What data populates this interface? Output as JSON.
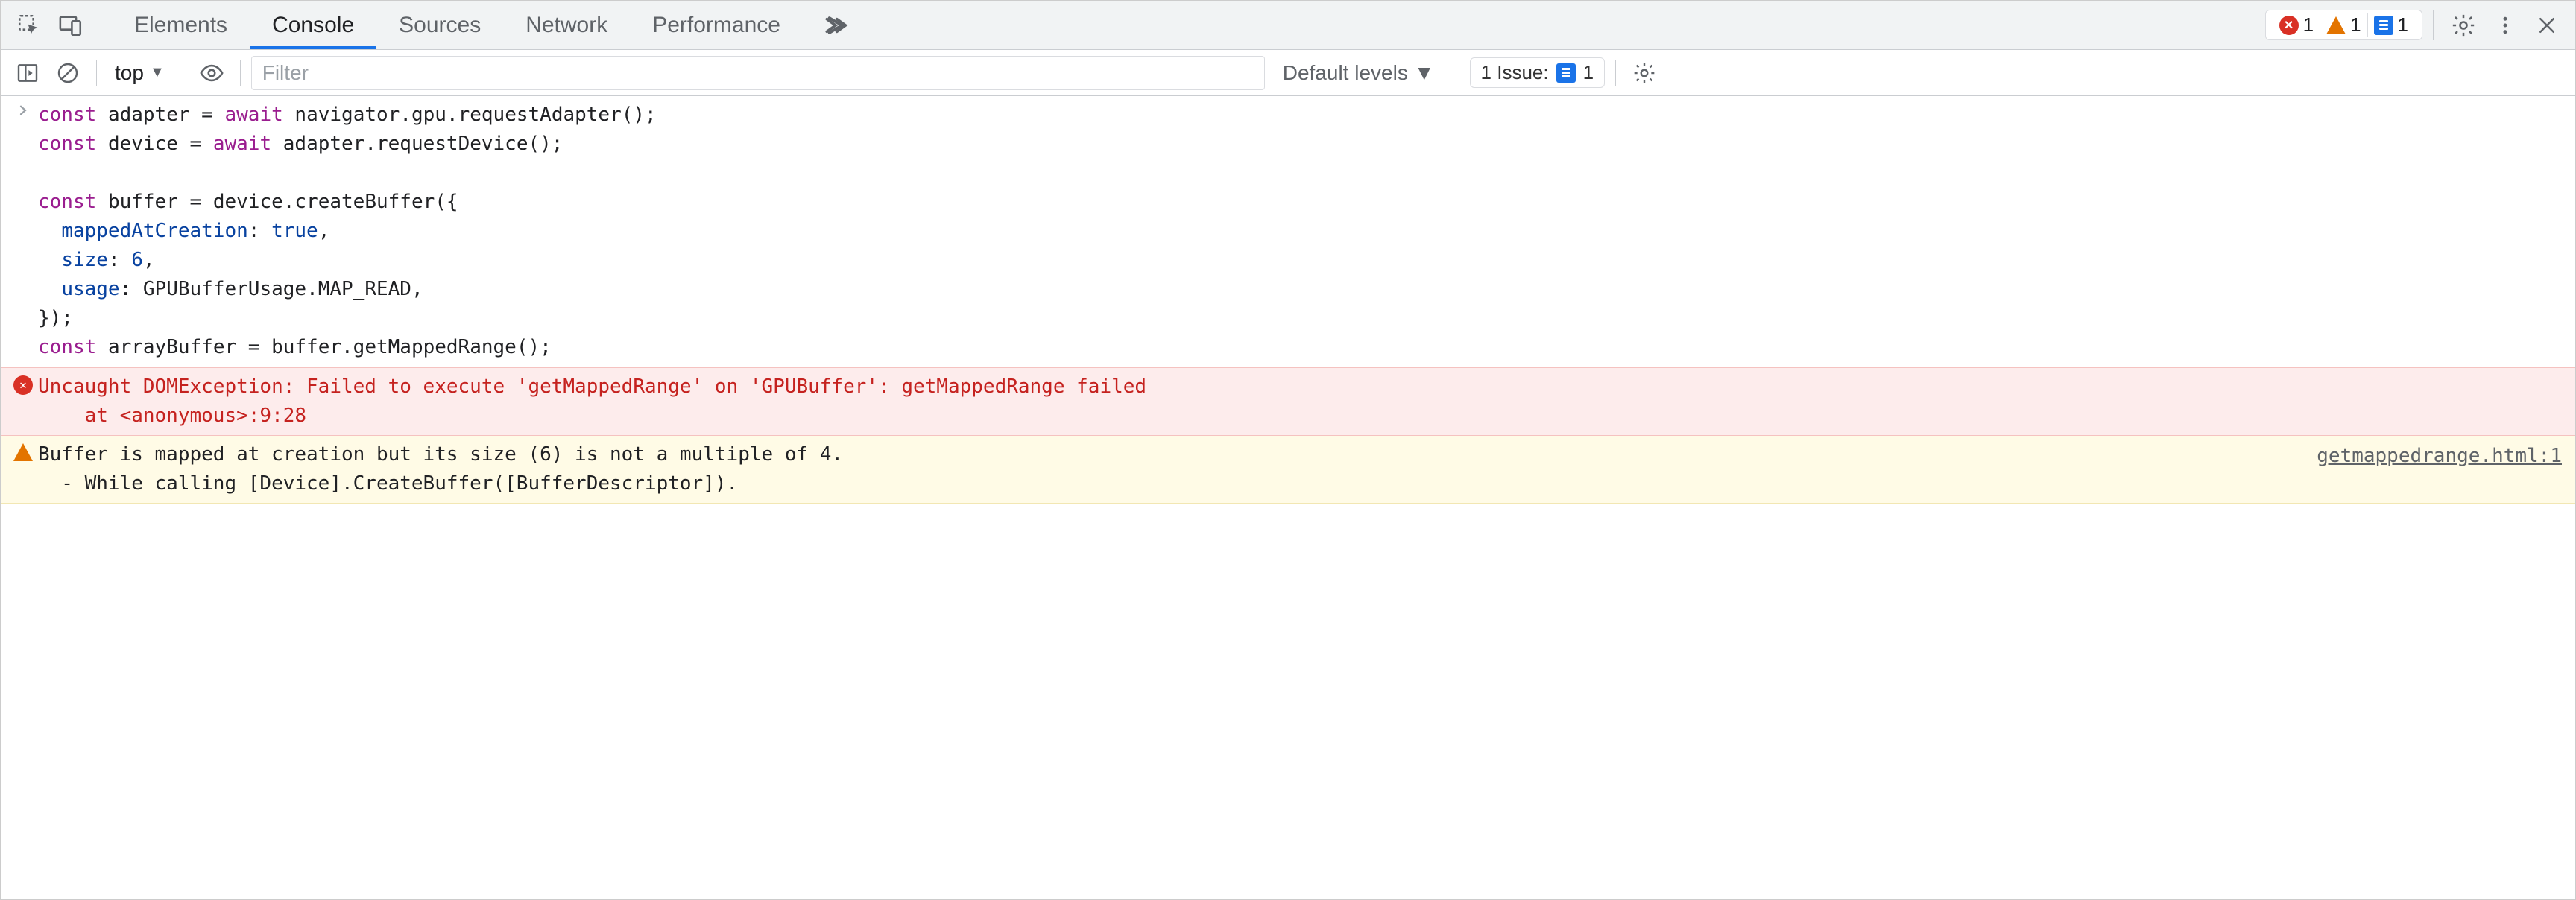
{
  "tabs": {
    "items": [
      "Elements",
      "Console",
      "Sources",
      "Network",
      "Performance"
    ],
    "active_index": 1
  },
  "badges": {
    "errors": "1",
    "warnings": "1",
    "info": "1"
  },
  "toolbar": {
    "context": "top",
    "filter_placeholder": "Filter",
    "levels_label": "Default levels",
    "issues_label": "1 Issue:",
    "issues_count": "1"
  },
  "code": {
    "tokens": [
      [
        "kw",
        "const"
      ],
      [
        "sp",
        " "
      ],
      [
        "ident",
        "adapter"
      ],
      [
        "sp",
        " "
      ],
      [
        "pun",
        "="
      ],
      [
        "sp",
        " "
      ],
      [
        "await",
        "await"
      ],
      [
        "sp",
        " "
      ],
      [
        "ident",
        "navigator"
      ],
      [
        "pun",
        "."
      ],
      [
        "ident",
        "gpu"
      ],
      [
        "pun",
        "."
      ],
      [
        "ident",
        "requestAdapter"
      ],
      [
        "pun",
        "();"
      ],
      [
        "nl"
      ],
      [
        "kw",
        "const"
      ],
      [
        "sp",
        " "
      ],
      [
        "ident",
        "device"
      ],
      [
        "sp",
        " "
      ],
      [
        "pun",
        "="
      ],
      [
        "sp",
        " "
      ],
      [
        "await",
        "await"
      ],
      [
        "sp",
        " "
      ],
      [
        "ident",
        "adapter"
      ],
      [
        "pun",
        "."
      ],
      [
        "ident",
        "requestDevice"
      ],
      [
        "pun",
        "();"
      ],
      [
        "nl"
      ],
      [
        "nl"
      ],
      [
        "kw",
        "const"
      ],
      [
        "sp",
        " "
      ],
      [
        "ident",
        "buffer"
      ],
      [
        "sp",
        " "
      ],
      [
        "pun",
        "="
      ],
      [
        "sp",
        " "
      ],
      [
        "ident",
        "device"
      ],
      [
        "pun",
        "."
      ],
      [
        "ident",
        "createBuffer"
      ],
      [
        "pun",
        "({"
      ],
      [
        "nl"
      ],
      [
        "sp",
        "  "
      ],
      [
        "prop",
        "mappedAtCreation"
      ],
      [
        "pun",
        ":"
      ],
      [
        "sp",
        " "
      ],
      [
        "bool",
        "true"
      ],
      [
        "pun",
        ","
      ],
      [
        "nl"
      ],
      [
        "sp",
        "  "
      ],
      [
        "prop",
        "size"
      ],
      [
        "pun",
        ":"
      ],
      [
        "sp",
        " "
      ],
      [
        "num",
        "6"
      ],
      [
        "pun",
        ","
      ],
      [
        "nl"
      ],
      [
        "sp",
        "  "
      ],
      [
        "prop",
        "usage"
      ],
      [
        "pun",
        ":"
      ],
      [
        "sp",
        " "
      ],
      [
        "ident",
        "GPUBufferUsage"
      ],
      [
        "pun",
        "."
      ],
      [
        "ident",
        "MAP_READ"
      ],
      [
        "pun",
        ","
      ],
      [
        "nl"
      ],
      [
        "pun",
        "});"
      ],
      [
        "nl"
      ],
      [
        "kw",
        "const"
      ],
      [
        "sp",
        " "
      ],
      [
        "ident",
        "arrayBuffer"
      ],
      [
        "sp",
        " "
      ],
      [
        "pun",
        "="
      ],
      [
        "sp",
        " "
      ],
      [
        "ident",
        "buffer"
      ],
      [
        "pun",
        "."
      ],
      [
        "ident",
        "getMappedRange"
      ],
      [
        "pun",
        "();"
      ]
    ]
  },
  "error": {
    "line1": "Uncaught DOMException: Failed to execute 'getMappedRange' on 'GPUBuffer': getMappedRange failed",
    "line2": "    at <anonymous>:9:28"
  },
  "warn": {
    "line1": "Buffer is mapped at creation but its size (6) is not a multiple of 4.",
    "line2": "  - While calling [Device].CreateBuffer([BufferDescriptor]).",
    "source": "getmappedrange.html:1"
  }
}
